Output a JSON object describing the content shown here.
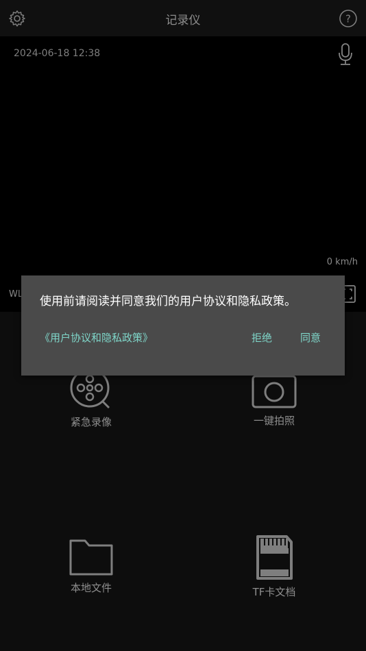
{
  "header": {
    "title": "记录仪",
    "settings_icon": "gear-icon",
    "help_icon": "help-icon"
  },
  "video": {
    "datetime": "2024-06-18 12:38",
    "mic_icon": "microphone-icon",
    "speed": "0 km/h",
    "wifi_label": "WL",
    "fullscreen_icon": "fullscreen-icon"
  },
  "actions": [
    {
      "label": "紧急录像",
      "icon": "film-reel-icon"
    },
    {
      "label": "一键拍照",
      "icon": "camera-icon"
    },
    {
      "label": "本地文件",
      "icon": "folder-icon"
    },
    {
      "label": "TF卡文档",
      "icon": "sd-card-icon"
    }
  ],
  "dialog": {
    "message": "使用前请阅读并同意我们的用户协议和隐私政策。",
    "policy_link": "《用户协议和隐私政策》",
    "reject": "拒绝",
    "agree": "同意",
    "accent_color": "#7fd6c9"
  }
}
